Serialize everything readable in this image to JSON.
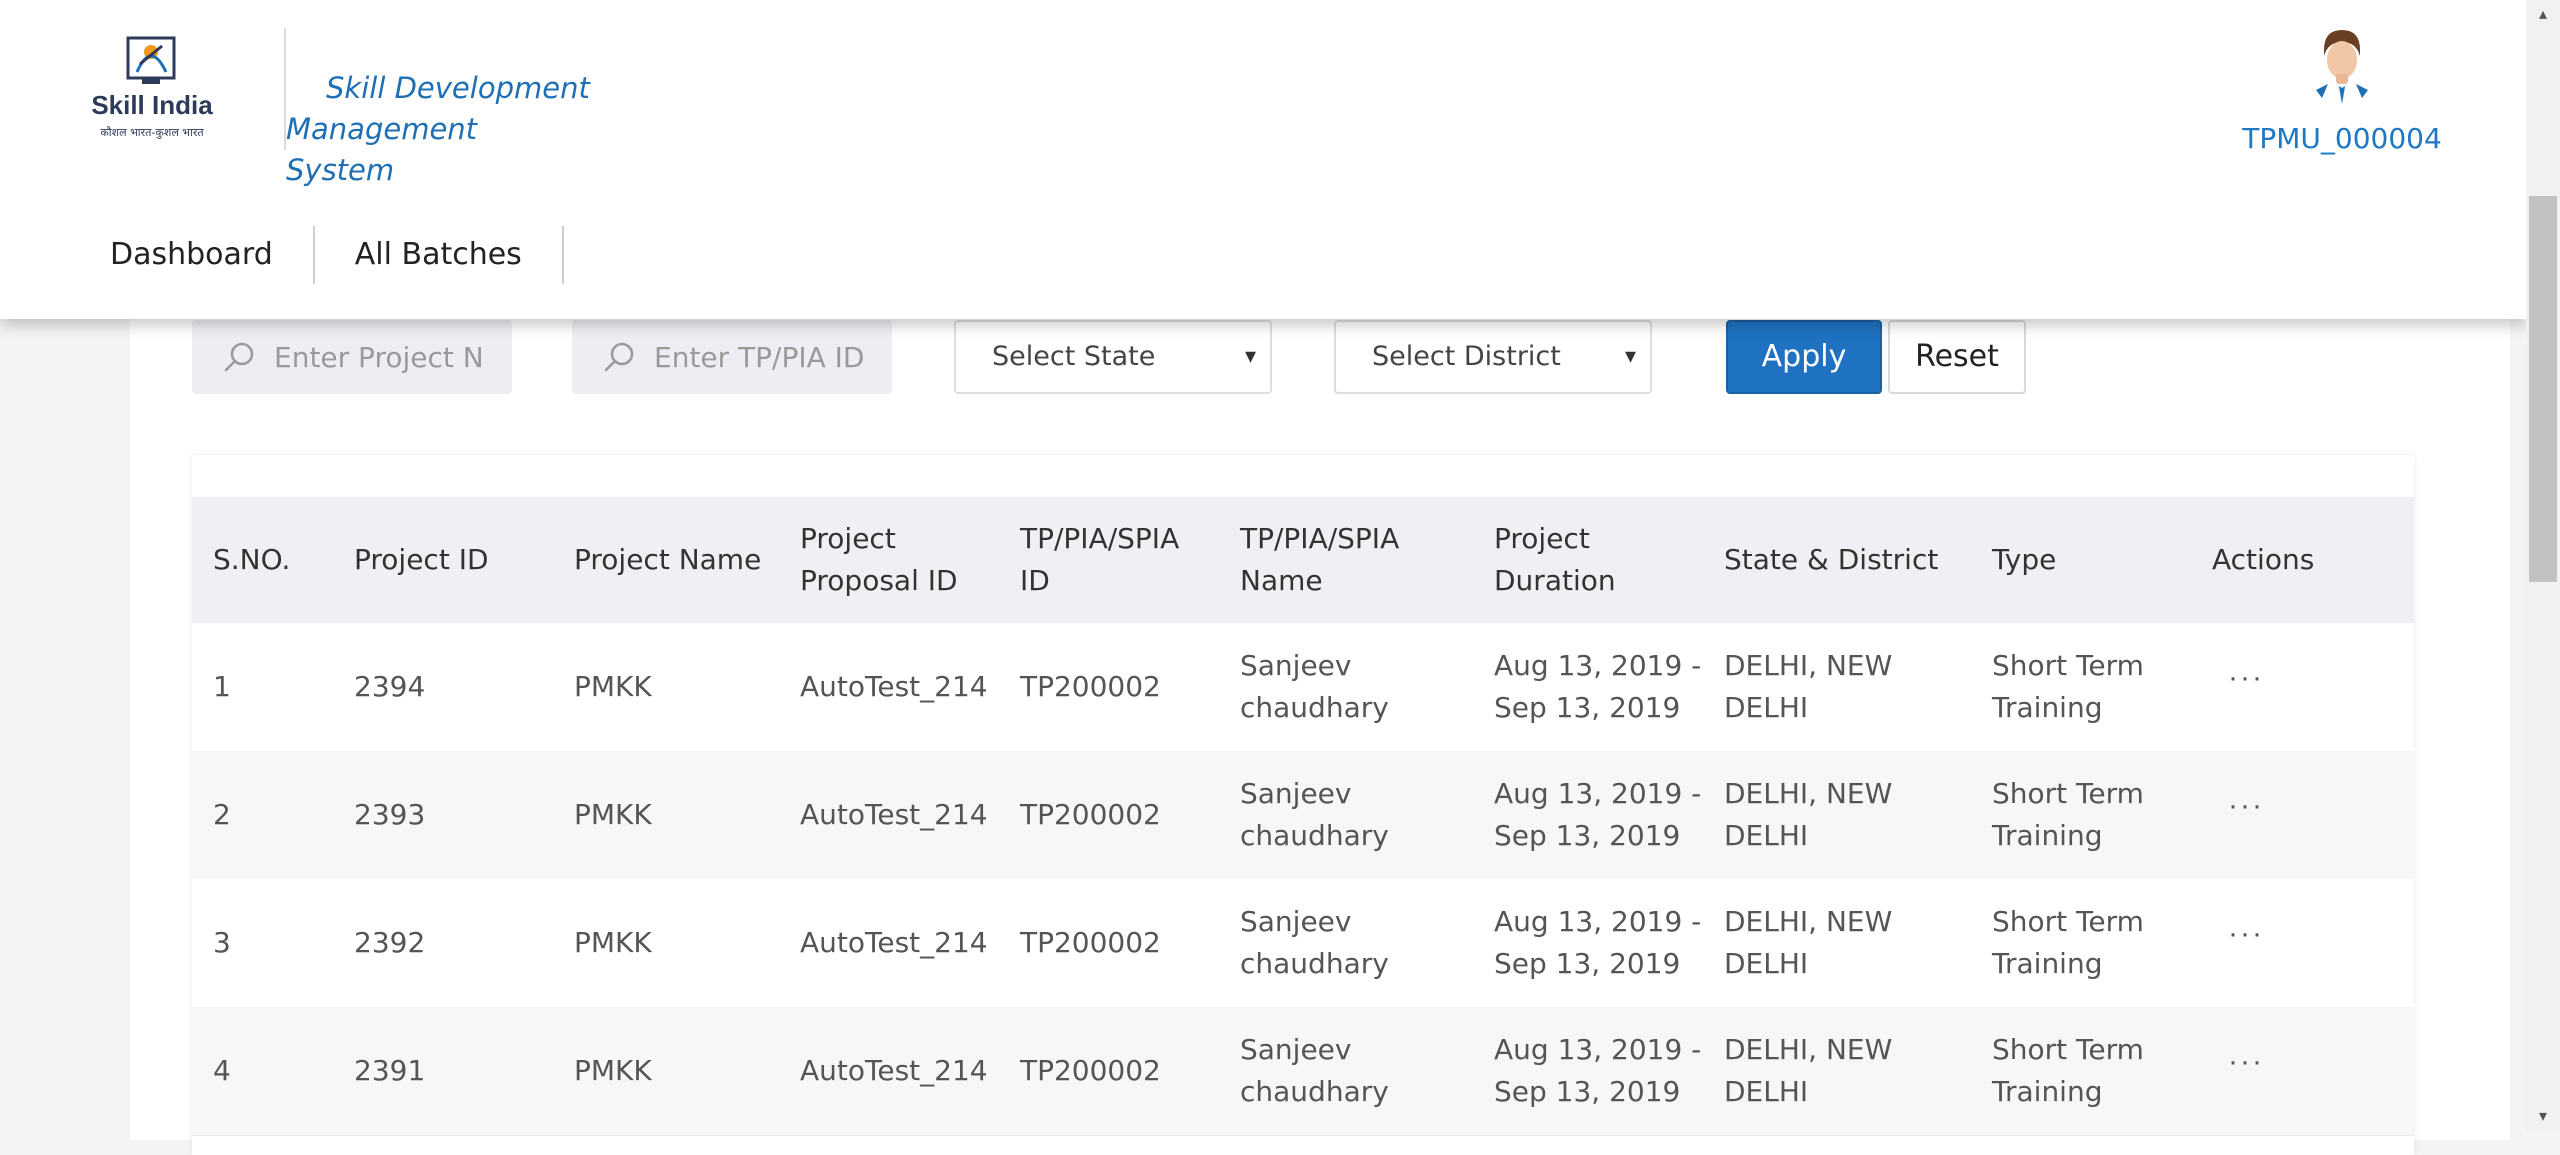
{
  "header": {
    "logo": {
      "text": "Skill India",
      "subtext": "कौशल भारत-कुशल भारत"
    },
    "app_title_line1": "Skill Development Management",
    "app_title_line2": "System",
    "user_id": "TPMU_000004"
  },
  "nav": {
    "items": [
      {
        "label": "Dashboard"
      },
      {
        "label": "All Batches"
      }
    ]
  },
  "filters": {
    "project_name_placeholder": "Enter Project Name",
    "tp_pia_placeholder": "Enter TP/PIA ID",
    "state_select": "Select State",
    "district_select": "Select District",
    "apply_label": "Apply",
    "reset_label": "Reset"
  },
  "table": {
    "headers": {
      "sno": "S.NO.",
      "project_id": "Project ID",
      "project_name": "Project Name",
      "proposal_id_1": "Project",
      "proposal_id_2": "Proposal ID",
      "tp_id_1": "TP/PIA/SPIA",
      "tp_id_2": "ID",
      "tp_name_1": "TP/PIA/SPIA",
      "tp_name_2": "Name",
      "duration_1": "Project",
      "duration_2": "Duration",
      "state_district": "State & District",
      "type": "Type",
      "actions": "Actions"
    },
    "rows": [
      {
        "sno": "1",
        "project_id": "2394",
        "project_name": "PMKK",
        "proposal_id": "AutoTest_214",
        "tp_id": "TP200002",
        "tp_name_1": "Sanjeev",
        "tp_name_2": "chaudhary",
        "duration_1": "Aug 13, 2019 -",
        "duration_2": "Sep 13, 2019",
        "state_1": "DELHI, NEW",
        "state_2": "DELHI",
        "type_1": "Short Term",
        "type_2": "Training",
        "actions": "···"
      },
      {
        "sno": "2",
        "project_id": "2393",
        "project_name": "PMKK",
        "proposal_id": "AutoTest_214",
        "tp_id": "TP200002",
        "tp_name_1": "Sanjeev",
        "tp_name_2": "chaudhary",
        "duration_1": "Aug 13, 2019 -",
        "duration_2": "Sep 13, 2019",
        "state_1": "DELHI, NEW",
        "state_2": "DELHI",
        "type_1": "Short Term",
        "type_2": "Training",
        "actions": "···"
      },
      {
        "sno": "3",
        "project_id": "2392",
        "project_name": "PMKK",
        "proposal_id": "AutoTest_214",
        "tp_id": "TP200002",
        "tp_name_1": "Sanjeev",
        "tp_name_2": "chaudhary",
        "duration_1": "Aug 13, 2019 -",
        "duration_2": "Sep 13, 2019",
        "state_1": "DELHI, NEW",
        "state_2": "DELHI",
        "type_1": "Short Term",
        "type_2": "Training",
        "actions": "···"
      },
      {
        "sno": "4",
        "project_id": "2391",
        "project_name": "PMKK",
        "proposal_id": "AutoTest_214",
        "tp_id": "TP200002",
        "tp_name_1": "Sanjeev",
        "tp_name_2": "chaudhary",
        "duration_1": "Aug 13, 2019 -",
        "duration_2": "Sep 13, 2019",
        "state_1": "DELHI, NEW",
        "state_2": "DELHI",
        "type_1": "Short Term",
        "type_2": "Training",
        "actions": "···"
      }
    ]
  },
  "colors": {
    "accent": "#1f72c1",
    "title_blue": "#1f6fb5",
    "header_bg": "#f0f0f4"
  }
}
